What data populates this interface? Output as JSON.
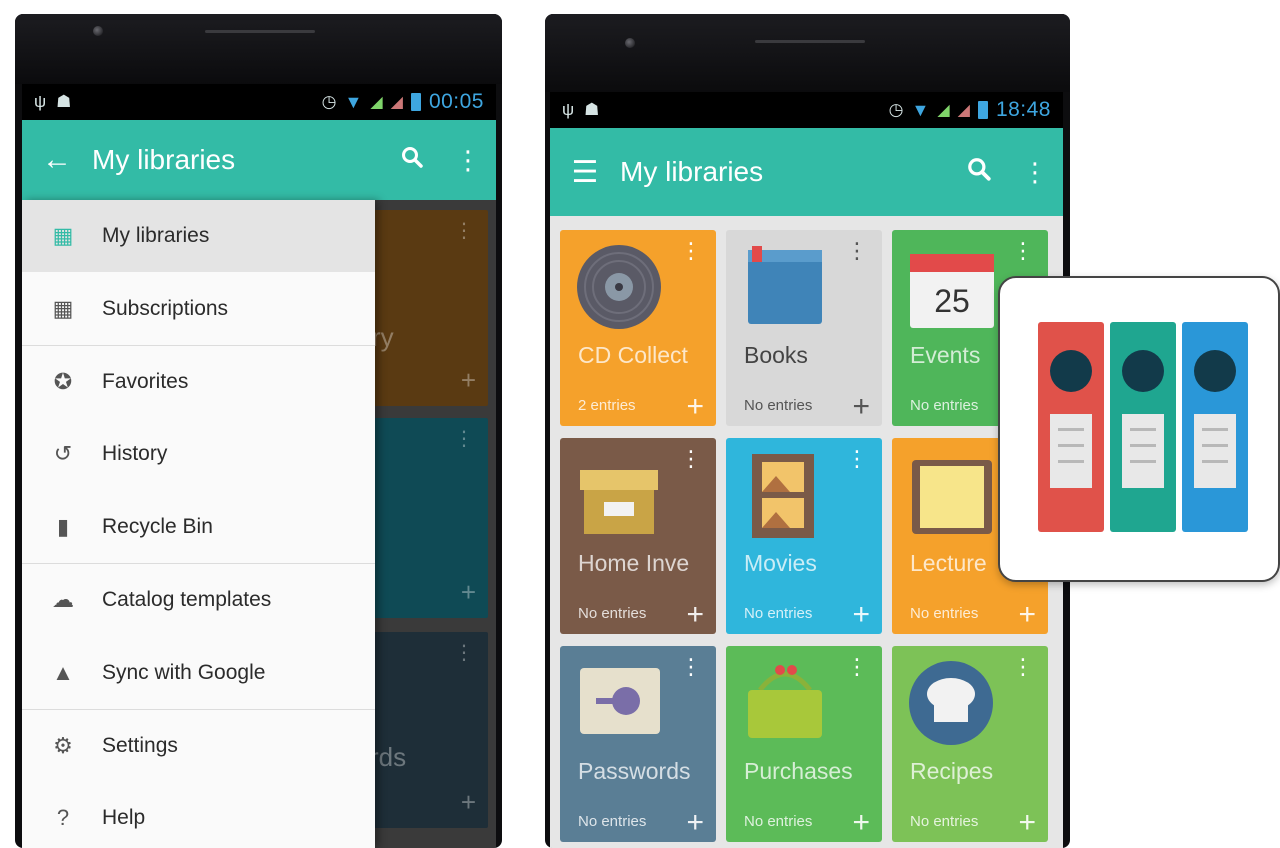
{
  "left_phone": {
    "status": {
      "time": "00:05"
    },
    "appbar": {
      "title": "My libraries",
      "back_icon": "arrow-left-icon",
      "search_icon": "search-icon",
      "overflow_icon": "more-vert-icon"
    },
    "drawer": {
      "items": [
        {
          "label": "My libraries",
          "icon": "grid-icon",
          "active": true
        },
        {
          "label": "Subscriptions",
          "icon": "grid-icon"
        },
        {
          "label": "Favorites",
          "icon": "star-circle-icon"
        },
        {
          "label": "History",
          "icon": "history-icon"
        },
        {
          "label": "Recycle Bin",
          "icon": "trash-icon"
        },
        {
          "label": "Catalog templates",
          "icon": "cloud-icon"
        },
        {
          "label": "Sync with Google",
          "icon": "google-drive-icon"
        },
        {
          "label": "Settings",
          "icon": "gear-icon"
        },
        {
          "label": "Help",
          "icon": "help-icon"
        }
      ]
    },
    "background_cards": [
      {
        "partial_text": "ry",
        "color": "#5a3a12"
      },
      {
        "partial_text": "",
        "color": "#0f4a55"
      },
      {
        "partial_text": "rds",
        "color": "#1e2e38"
      }
    ]
  },
  "right_phone": {
    "status": {
      "time": "18:48"
    },
    "appbar": {
      "title": "My libraries",
      "menu_icon": "hamburger-icon",
      "search_icon": "search-icon",
      "overflow_icon": "more-vert-icon"
    },
    "tiles": [
      {
        "name": "CD Collect",
        "count": "2 entries",
        "color": "#f5a12b",
        "art": "vinyl-disc-icon"
      },
      {
        "name": "Books",
        "count": "No entries",
        "color": "#d8d8d8",
        "art": "book-icon",
        "light": true
      },
      {
        "name": "Events",
        "count": "No entries",
        "color": "#4fb65a",
        "art": "calendar-icon",
        "calendar_day": "25"
      },
      {
        "name": "Home Inve",
        "count": "No entries",
        "color": "#7a5a48",
        "art": "storage-box-icon"
      },
      {
        "name": "Movies",
        "count": "No entries",
        "color": "#2fb6dc",
        "art": "film-strip-icon"
      },
      {
        "name": "Lecture",
        "count": "No entries",
        "color": "#f5a12b",
        "art": "notepad-icon"
      },
      {
        "name": "Passwords",
        "count": "No entries",
        "color": "#5a7e95",
        "art": "safe-icon"
      },
      {
        "name": "Purchases",
        "count": "No entries",
        "color": "#5cbb58",
        "art": "basket-icon"
      },
      {
        "name": "Recipes",
        "count": "No entries",
        "color": "#7dc257",
        "art": "chef-hat-icon"
      }
    ]
  },
  "popup": {
    "binders": [
      {
        "color": "#e0524a"
      },
      {
        "color": "#1fa690"
      },
      {
        "color": "#2a97d8"
      }
    ]
  }
}
